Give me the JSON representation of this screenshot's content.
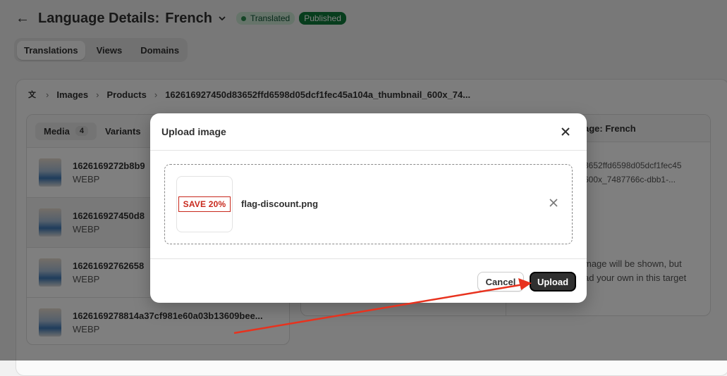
{
  "header": {
    "back_icon": "arrow-left-icon",
    "title": "Language Details:",
    "language": "French",
    "status_badge": "Translated",
    "publish_badge": "Published"
  },
  "tabs": [
    {
      "label": "Translations",
      "active": true
    },
    {
      "label": "Views"
    },
    {
      "label": "Domains"
    }
  ],
  "breadcrumb": {
    "icon": "translate-icon",
    "items": [
      "Images",
      "Products",
      "162616927450d83652ffd6598d05dcf1fec45a104a_thumbnail_600x_74..."
    ]
  },
  "left_panel": {
    "tabs": [
      {
        "label": "Media",
        "count": "4"
      },
      {
        "label": "Variants"
      }
    ],
    "rows": [
      {
        "name": "1626169272b8b9",
        "type": "WEBP"
      },
      {
        "name": "162616927450d8",
        "type": "WEBP"
      },
      {
        "name": "16261692762658",
        "type": "WEBP"
      },
      {
        "name": "1626169278814a37cf981e60a03b13609bee...",
        "type": "WEBP"
      }
    ]
  },
  "right_panel": {
    "header": "age: French",
    "filename_line1": "3652ffd6598d05dcf1fec45",
    "filename_line2": "600x_7487766c-dbb1-...",
    "note_line1": "mage will be shown, but",
    "note_line2": "ad your own in this target"
  },
  "modal": {
    "title": "Upload image",
    "file": {
      "thumb_text": "SAVE 20%",
      "name": "flag-discount.png"
    },
    "cancel_label": "Cancel",
    "upload_label": "Upload"
  },
  "colors": {
    "accent_green": "#0e7a3a",
    "annotation_arrow": "#e8321e"
  }
}
